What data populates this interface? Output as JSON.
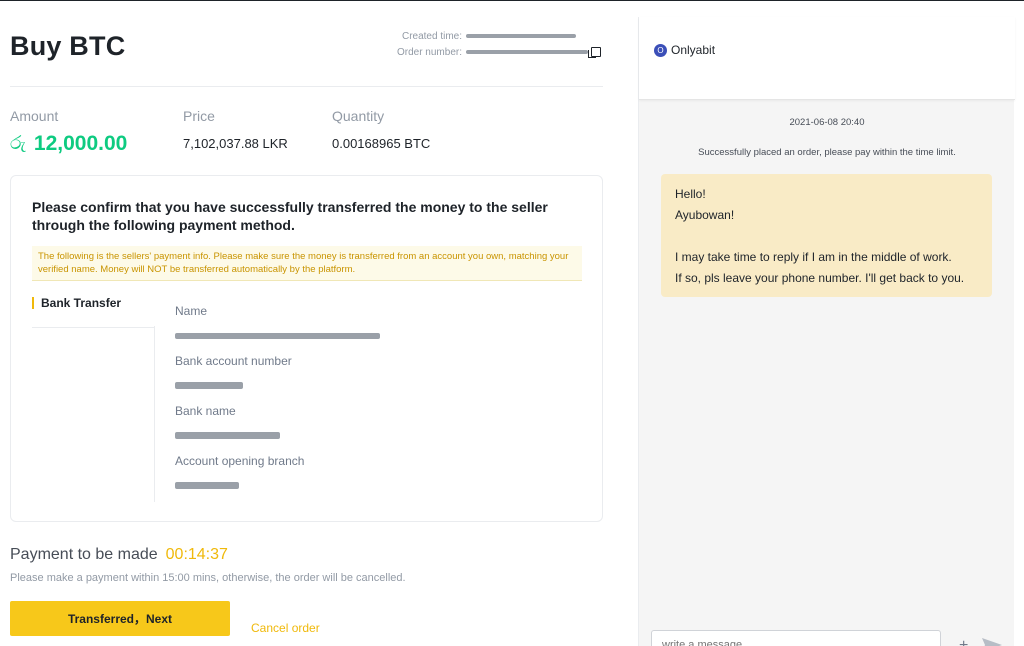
{
  "order": {
    "title": "Buy BTC",
    "created_label": "Created time:",
    "order_label": "Order number:"
  },
  "stats": {
    "amount_label": "Amount",
    "amount_currency": "රු",
    "amount_value": "12,000.00",
    "price_label": "Price",
    "price_value": "7,102,037.88 LKR",
    "quantity_label": "Quantity",
    "quantity_value": "0.00168965 BTC"
  },
  "payment_card": {
    "heading": "Please confirm that you have successfully transferred the money to the seller through the following payment method.",
    "notice": "The following is the sellers' payment info. Please make sure the money is transferred from an account you own, matching your verified name. Money will NOT be transferred automatically by the platform.",
    "method": "Bank Transfer",
    "fields": [
      {
        "label": "Name"
      },
      {
        "label": "Bank account number"
      },
      {
        "label": "Bank name"
      },
      {
        "label": "Account opening branch"
      }
    ]
  },
  "payment": {
    "title": "Payment to be made",
    "timer": "00:14:37",
    "note": "Please make a payment within 15:00 mins, otherwise, the order will be cancelled.",
    "next_button": "Transferred，Next",
    "cancel_button": "Cancel order"
  },
  "chat": {
    "seller_initial": "O",
    "seller_name": "Onlyabit",
    "date": "2021-06-08 20:40",
    "system_message": "Successfully placed an order, please pay within the time limit.",
    "message_lines": [
      "Hello!",
      "Ayubowan!",
      "I may take time to reply if I am in the middle of work.",
      "If so, pls leave your phone number. I'll get back to you."
    ],
    "input_placeholder": "write a message",
    "plus_symbol": "+"
  },
  "colors": {
    "accent_yellow": "#f0b90b",
    "amount_green": "#0ecb81",
    "bubble_bg": "#f9ebc6"
  }
}
